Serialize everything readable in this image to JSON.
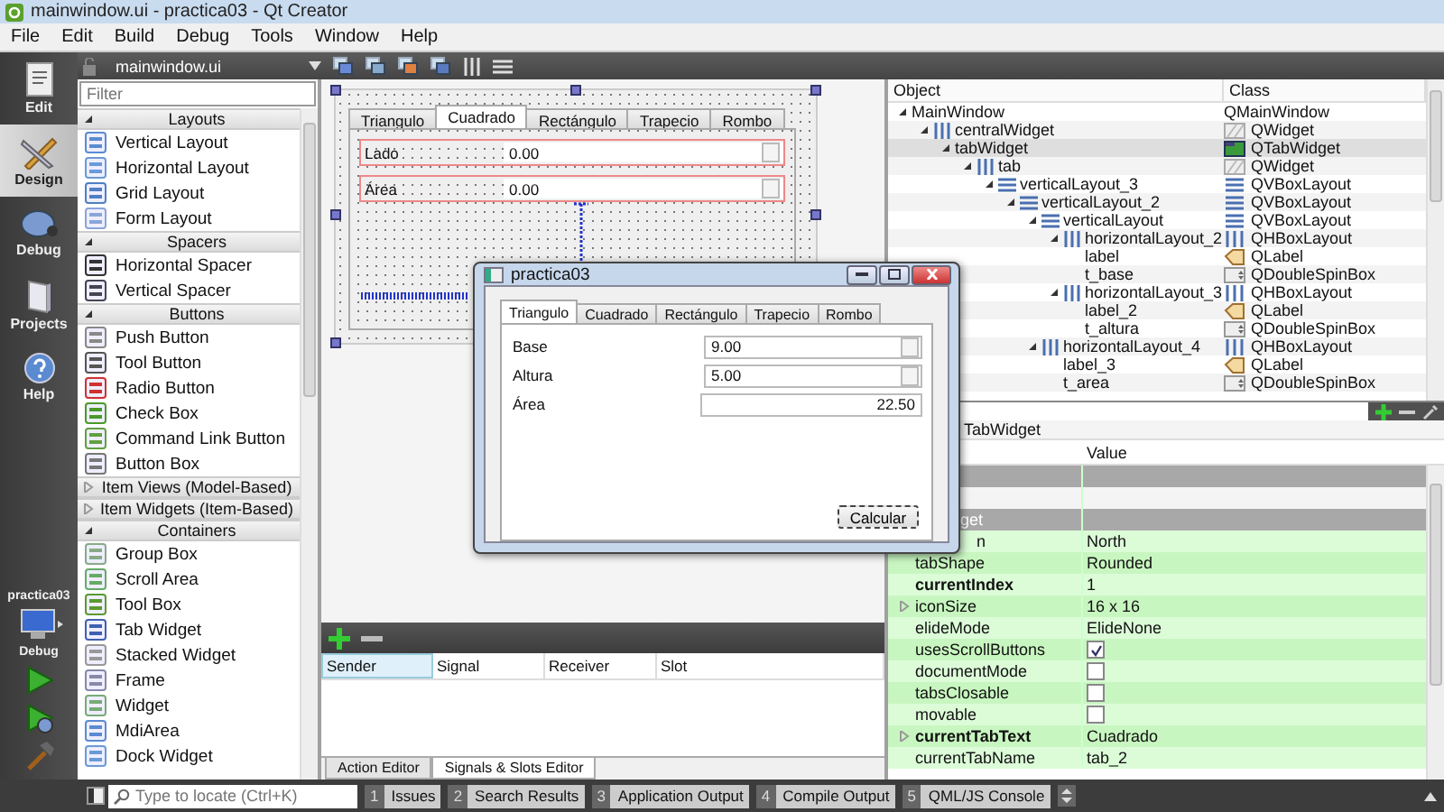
{
  "window": {
    "title": "mainwindow.ui - practica03 - Qt Creator"
  },
  "menu": [
    "File",
    "Edit",
    "Build",
    "Debug",
    "Tools",
    "Window",
    "Help"
  ],
  "modes": [
    {
      "label": "Edit",
      "selected": false
    },
    {
      "label": "Design",
      "selected": true
    },
    {
      "label": "Debug",
      "selected": false
    },
    {
      "label": "Projects",
      "selected": false
    },
    {
      "label": "Help",
      "selected": false
    }
  ],
  "target": {
    "project": "practica03",
    "config": "Debug"
  },
  "editor_toolbar": {
    "file": "mainwindow.ui"
  },
  "widget_box": {
    "placeholder": "Filter",
    "groups": [
      {
        "title": "Layouts",
        "expanded": true,
        "items": [
          "Vertical Layout",
          "Horizontal Layout",
          "Grid Layout",
          "Form Layout"
        ]
      },
      {
        "title": "Spacers",
        "expanded": true,
        "items": [
          "Horizontal Spacer",
          "Vertical Spacer"
        ]
      },
      {
        "title": "Buttons",
        "expanded": true,
        "items": [
          "Push Button",
          "Tool Button",
          "Radio Button",
          "Check Box",
          "Command Link Button",
          "Button Box"
        ]
      },
      {
        "title": "Item Views (Model-Based)",
        "expanded": false
      },
      {
        "title": "Item Widgets (Item-Based)",
        "expanded": false
      },
      {
        "title": "Containers",
        "expanded": true,
        "items": [
          "Group Box",
          "Scroll Area",
          "Tool Box",
          "Tab Widget",
          "Stacked Widget",
          "Frame",
          "Widget",
          "MdiArea",
          "Dock Widget"
        ]
      }
    ]
  },
  "form": {
    "tabs": [
      {
        "label": "Triangulo",
        "selected": false
      },
      {
        "label": "Cuadrado",
        "selected": true
      },
      {
        "label": "Rectángulo",
        "selected": false
      },
      {
        "label": "Trapecio",
        "selected": false
      },
      {
        "label": "Rombo",
        "selected": false
      }
    ],
    "fields": [
      {
        "label": "Lado",
        "value": "0.00"
      },
      {
        "label": "Área",
        "value": "0.00"
      }
    ]
  },
  "preview_window": {
    "title": "practica03",
    "tabs": [
      {
        "label": "Triangulo",
        "selected": true
      },
      {
        "label": "Cuadrado",
        "selected": false
      },
      {
        "label": "Rectángulo",
        "selected": false
      },
      {
        "label": "Trapecio",
        "selected": false
      },
      {
        "label": "Rombo",
        "selected": false
      }
    ],
    "fields": [
      {
        "label": "Base",
        "value": "9.00",
        "kind": "spin"
      },
      {
        "label": "Altura",
        "value": "5.00",
        "kind": "spin"
      },
      {
        "label": "Área",
        "value": "22.50",
        "kind": "readonly"
      }
    ],
    "button": "Calcular"
  },
  "signal_slot_editor": {
    "columns": [
      "Sender",
      "Signal",
      "Receiver",
      "Slot"
    ],
    "tabs": [
      {
        "label": "Action Editor",
        "selected": false
      },
      {
        "label": "Signals & Slots Editor",
        "selected": true
      }
    ]
  },
  "object_inspector": {
    "columns": [
      "Object",
      "Class"
    ],
    "tree": [
      {
        "name": "MainWindow",
        "class": "QMainWindow",
        "selected": false,
        "expanded": true,
        "children": [
          {
            "name": "centralWidget",
            "class": "QWidget",
            "kind": "widget",
            "selected": false,
            "expanded": true,
            "children": [
              {
                "name": "tabWidget",
                "class": "QTabWidget",
                "kind": "tabwidget",
                "selected": true,
                "expanded": true,
                "children": [
                  {
                    "name": "tab",
                    "class": "QWidget",
                    "kind": "widget",
                    "selected": false,
                    "expanded": true,
                    "children": [
                      {
                        "name": "verticalLayout_3",
                        "class": "QVBoxLayout",
                        "kind": "vbox",
                        "selected": false,
                        "expanded": true,
                        "children": [
                          {
                            "name": "verticalLayout_2",
                            "class": "QVBoxLayout",
                            "kind": "vbox",
                            "selected": false,
                            "expanded": true,
                            "children": [
                              {
                                "name": "verticalLayout",
                                "class": "QVBoxLayout",
                                "kind": "vbox",
                                "selected": false,
                                "expanded": true,
                                "children": [
                                  {
                                    "name": "horizontalLayout_2",
                                    "class": "QHBoxLayout",
                                    "kind": "hbox",
                                    "selected": false,
                                    "expanded": true,
                                    "children": [
                                      {
                                        "name": "label",
                                        "class": "QLabel",
                                        "kind": "label",
                                        "selected": false
                                      },
                                      {
                                        "name": "t_base",
                                        "class": "QDoubleSpinBox",
                                        "kind": "spin",
                                        "selected": false
                                      }
                                    ]
                                  },
                                  {
                                    "name": "horizontalLayout_3",
                                    "class": "QHBoxLayout",
                                    "kind": "hbox",
                                    "selected": false,
                                    "expanded": true,
                                    "children": [
                                      {
                                        "name": "label_2",
                                        "class": "QLabel",
                                        "kind": "label",
                                        "selected": false
                                      },
                                      {
                                        "name": "t_altura",
                                        "class": "QDoubleSpinBox",
                                        "kind": "spin",
                                        "selected": false
                                      }
                                    ]
                                  }
                                ]
                              },
                              {
                                "name": "horizontalLayout_4",
                                "class": "QHBoxLayout",
                                "kind": "hbox",
                                "selected": false,
                                "expanded": true,
                                "children": [
                                  {
                                    "name": "label_3",
                                    "class": "QLabel",
                                    "kind": "label",
                                    "selected": false
                                  },
                                  {
                                    "name": "t_area",
                                    "class": "QDoubleSpinBox",
                                    "kind": "spin",
                                    "selected": false
                                  }
                                ]
                              }
                            ]
                          }
                        ]
                      }
                    ]
                  }
                ]
              }
            ]
          }
        ]
      }
    ]
  },
  "property_editor": {
    "selected_object": "TabWidget",
    "columns": [
      "Value"
    ],
    "rows": [
      {
        "kind": "section"
      },
      {
        "kind": "blank"
      },
      {
        "kind": "section",
        "name": "get"
      },
      {
        "kind": "text",
        "name": "n",
        "value": "North",
        "changed": false
      },
      {
        "kind": "text",
        "name": "tabShape",
        "value": "Rounded",
        "changed": false
      },
      {
        "kind": "text",
        "name": "currentIndex",
        "value": "1",
        "changed": true
      },
      {
        "kind": "text",
        "name": "iconSize",
        "value": "16 x 16",
        "changed": false,
        "expandable": true
      },
      {
        "kind": "text",
        "name": "elideMode",
        "value": "ElideNone",
        "changed": false
      },
      {
        "kind": "checkbox",
        "name": "usesScrollButtons",
        "checked": true
      },
      {
        "kind": "checkbox",
        "name": "documentMode",
        "checked": false
      },
      {
        "kind": "checkbox",
        "name": "tabsClosable",
        "checked": false
      },
      {
        "kind": "checkbox",
        "name": "movable",
        "checked": false
      },
      {
        "kind": "text",
        "name": "currentTabText",
        "value": "Cuadrado",
        "changed": true,
        "expandable": true
      },
      {
        "kind": "text",
        "name": "currentTabName",
        "value": "tab_2",
        "changed": false
      }
    ]
  },
  "status_bar": {
    "locate_placeholder": "Type to locate (Ctrl+K)",
    "panes": [
      {
        "number": "1",
        "label": "Issues"
      },
      {
        "number": "2",
        "label": "Search Results"
      },
      {
        "number": "3",
        "label": "Application Output"
      },
      {
        "number": "4",
        "label": "Compile Output"
      },
      {
        "number": "5",
        "label": "QML/JS Console"
      }
    ]
  }
}
